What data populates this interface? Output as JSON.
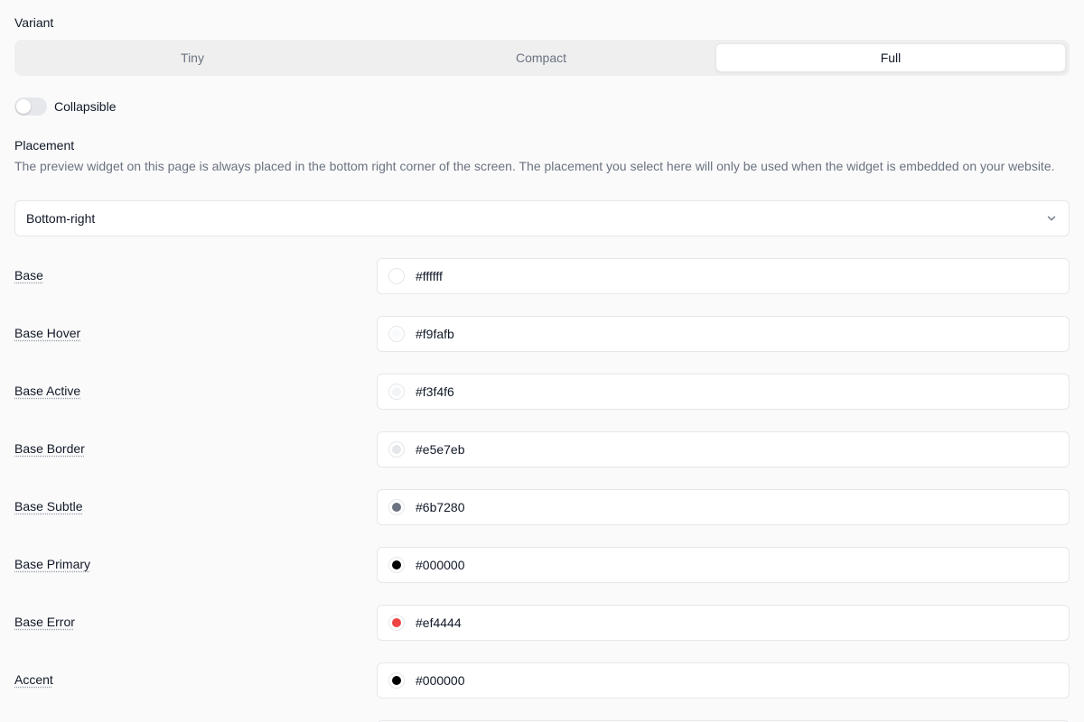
{
  "variant": {
    "label": "Variant",
    "options": [
      "Tiny",
      "Compact",
      "Full"
    ],
    "selected": "Full"
  },
  "collapsible": {
    "label": "Collapsible",
    "enabled": false
  },
  "placement": {
    "label": "Placement",
    "help": "The preview widget on this page is always placed in the bottom right corner of the screen. The placement you select here will only be used when the widget is embedded on your website.",
    "value": "Bottom-right"
  },
  "colors": [
    {
      "label": "Base",
      "value": "#ffffff",
      "swatch": "#ffffff"
    },
    {
      "label": "Base Hover",
      "value": "#f9fafb",
      "swatch": "#f9fafb"
    },
    {
      "label": "Base Active",
      "value": "#f3f4f6",
      "swatch": "#f3f4f6"
    },
    {
      "label": "Base Border",
      "value": "#e5e7eb",
      "swatch": "#e5e7eb"
    },
    {
      "label": "Base Subtle",
      "value": "#6b7280",
      "swatch": "#6b7280"
    },
    {
      "label": "Base Primary",
      "value": "#000000",
      "swatch": "#000000"
    },
    {
      "label": "Base Error",
      "value": "#ef4444",
      "swatch": "#ef4444"
    },
    {
      "label": "Accent",
      "value": "#000000",
      "swatch": "#000000"
    }
  ]
}
